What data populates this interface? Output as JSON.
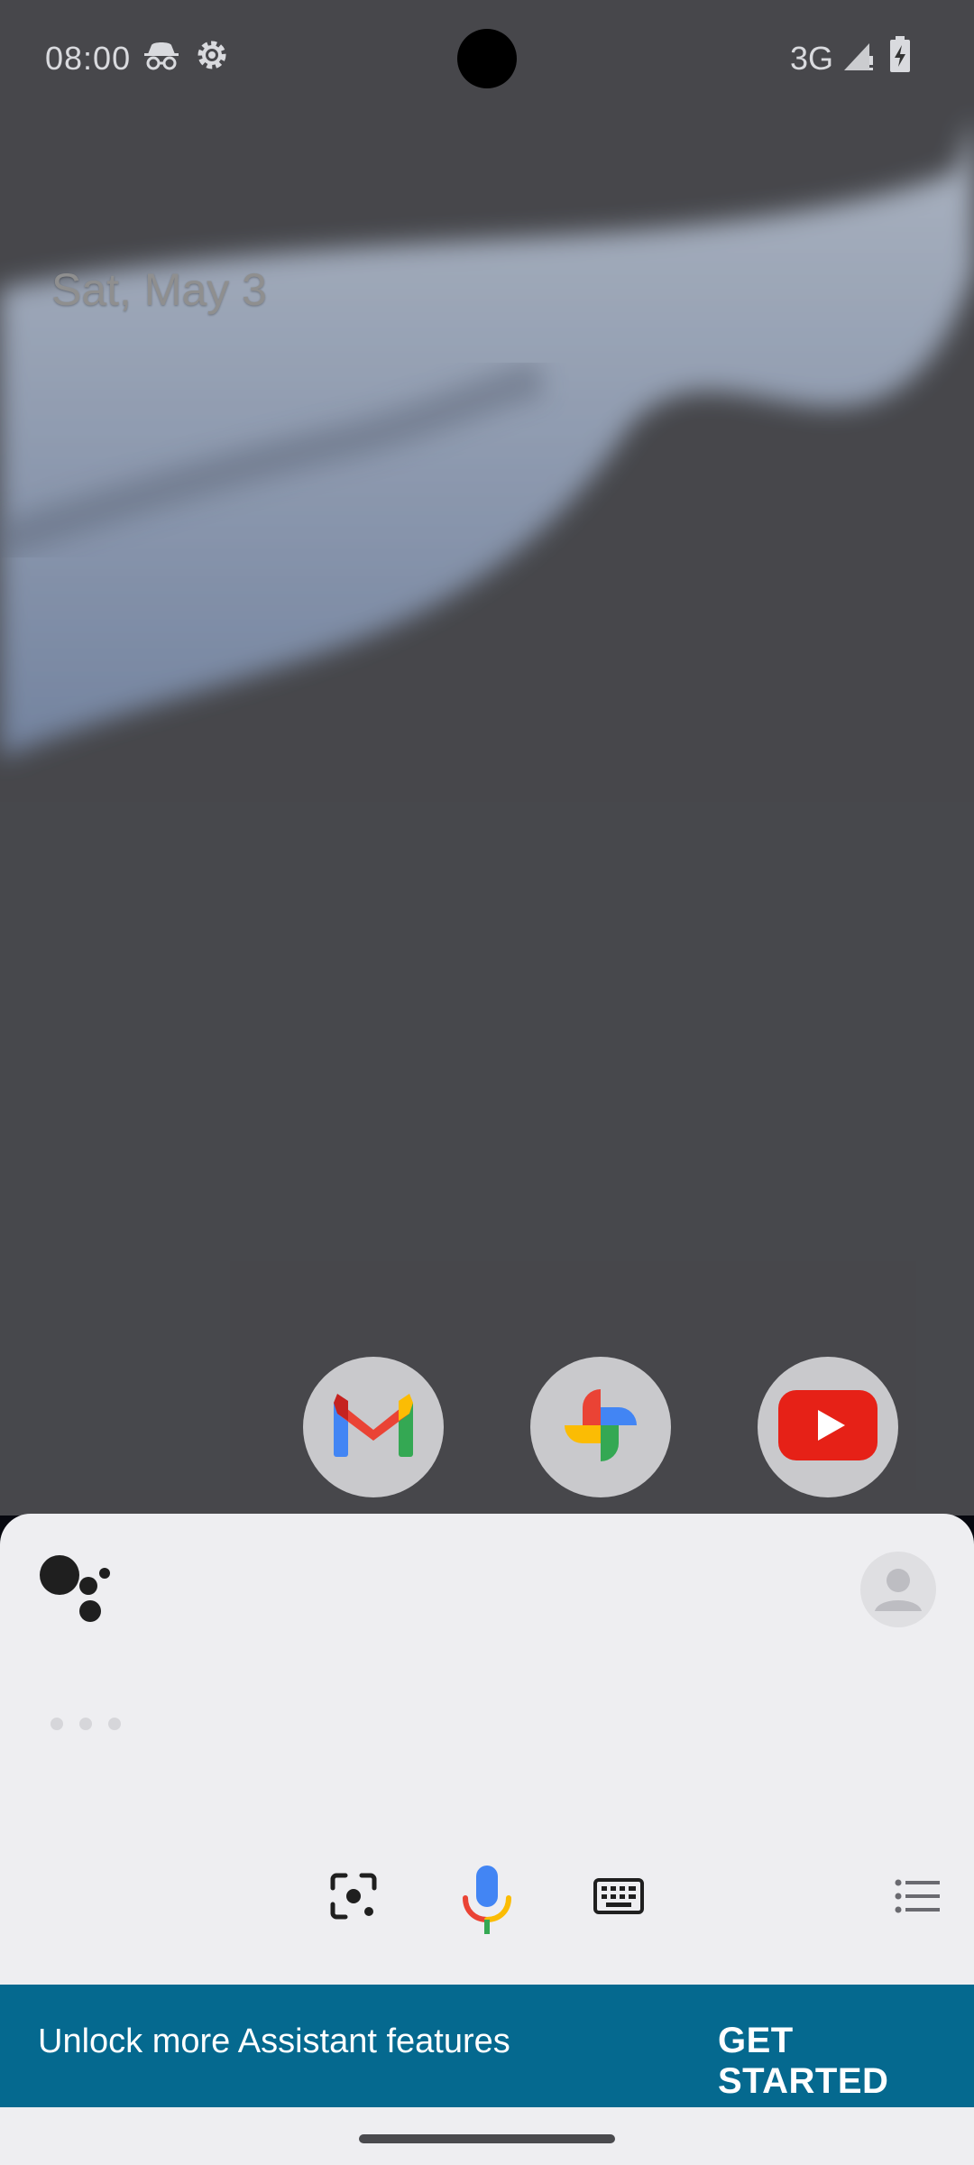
{
  "status_bar": {
    "time": "08:00",
    "network": "3G",
    "icons": [
      "incognito-icon",
      "settings-gear-icon",
      "signal-icon",
      "battery-charging-icon"
    ]
  },
  "home": {
    "date": "Sat, May 3",
    "dock_apps": [
      {
        "name": "Gmail",
        "icon": "gmail-icon"
      },
      {
        "name": "Photos",
        "icon": "photos-icon"
      },
      {
        "name": "YouTube",
        "icon": "youtube-icon"
      }
    ]
  },
  "assistant": {
    "buttons": [
      "lens-icon",
      "mic-icon",
      "keyboard-icon",
      "list-icon"
    ],
    "colors": {
      "sheet": "#eeeef1",
      "mic_blue": "#4285f4",
      "mic_red": "#ea4335",
      "mic_yellow": "#fbbc04",
      "mic_green": "#34a853"
    }
  },
  "promo": {
    "text": "Unlock more Assistant features",
    "cta": "GET STARTED",
    "color": "#05698f"
  }
}
